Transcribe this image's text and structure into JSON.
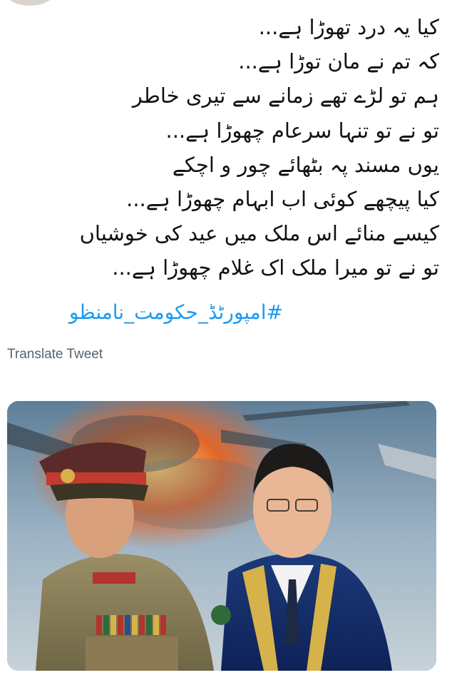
{
  "tweet": {
    "lines": [
      "کیا یہ درد تھوڑا ہے...",
      "کہ تم نے مان توڑا ہے...",
      "ہم تو لڑے تھے زمانے سے تیری خاطر",
      "تو نے تو تنہا سرعام چھوڑا ہے...",
      "یوں مسند پہ بٹھائے چور و اچکے",
      "کیا پیچھے کوئی اب ابہام چھوڑا ہے...",
      "کیسے منائے اس ملک میں عید کی خوشیاں",
      "تو نے تو میرا ملک اک غلام چھوڑا ہے..."
    ],
    "hashtag": "#امپورٹڈ_حکومت_نامنظو",
    "translate_label": "Translate Tweet"
  },
  "media": {
    "description_icon": "image-icon"
  },
  "colors": {
    "text": "#111111",
    "link": "#1d9bf0",
    "muted": "#536471",
    "background": "#ffffff"
  }
}
